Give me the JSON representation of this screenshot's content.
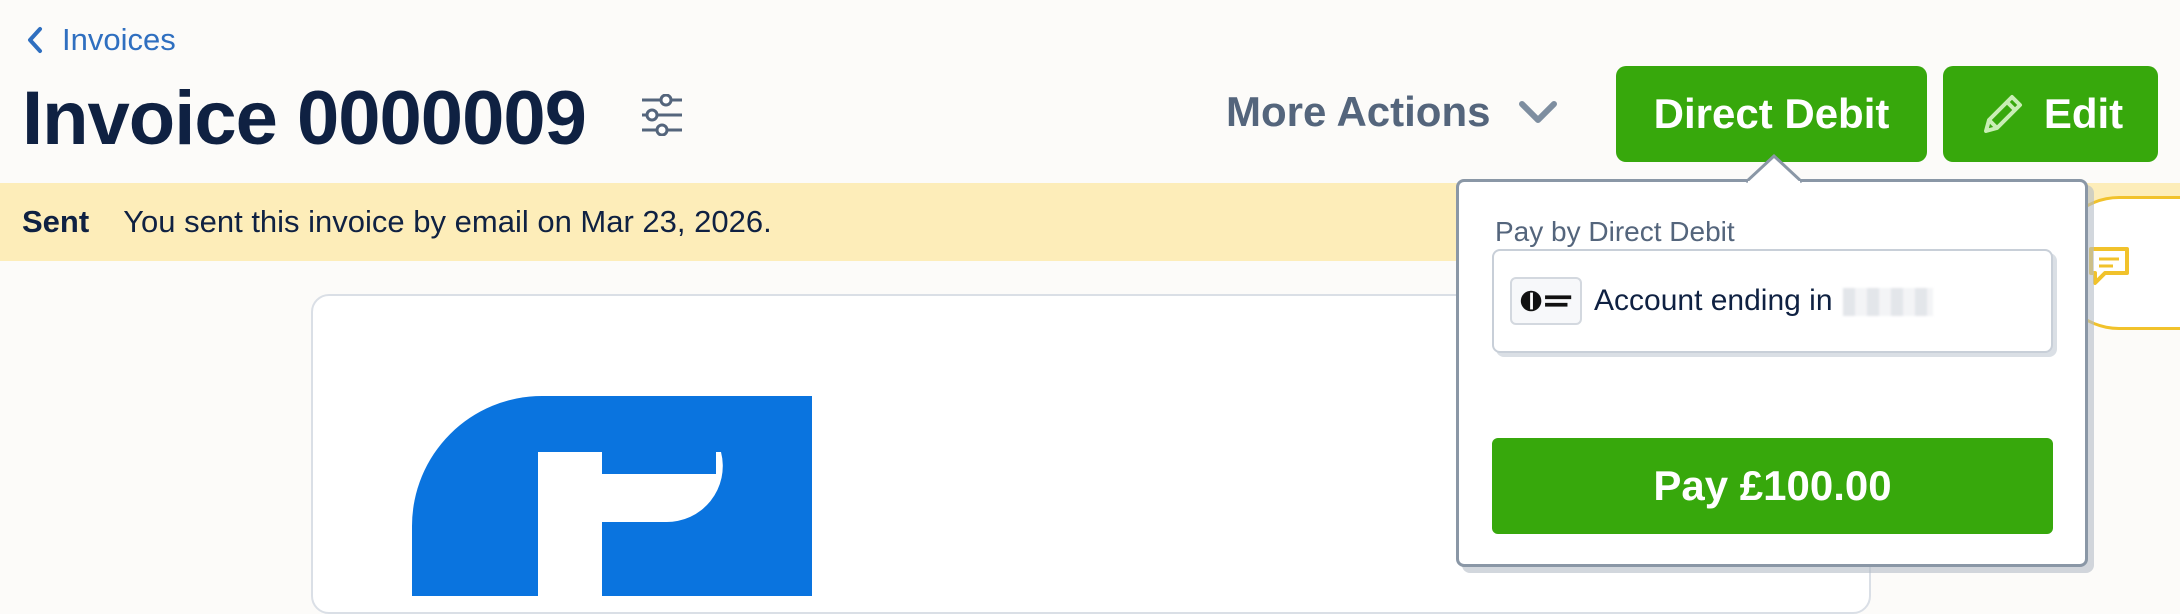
{
  "breadcrumb": {
    "label": "Invoices"
  },
  "header": {
    "title": "Invoice 0000009",
    "more_actions_label": "More Actions",
    "direct_debit_label": "Direct Debit",
    "edit_label": "Edit"
  },
  "banner": {
    "status": "Sent",
    "message": "You sent this invoice by email on Mar 23, 2026."
  },
  "popover": {
    "label": "Pay by Direct Debit",
    "account_text": "Account ending in",
    "pay_button_label": "Pay £100.00"
  },
  "colors": {
    "accent_green": "#37a80c",
    "title_navy": "#0f2142",
    "link_blue": "#2f6fc0",
    "banner_yellow": "#fdedb9",
    "logo_blue": "#0a74df"
  },
  "icons": {
    "back": "chevron-left-icon",
    "filter": "sliders-icon",
    "more_actions": "chevron-down-icon",
    "edit": "pencil-icon",
    "chat": "chat-icon",
    "direct_debit": "direct-debit-logo-icon"
  }
}
